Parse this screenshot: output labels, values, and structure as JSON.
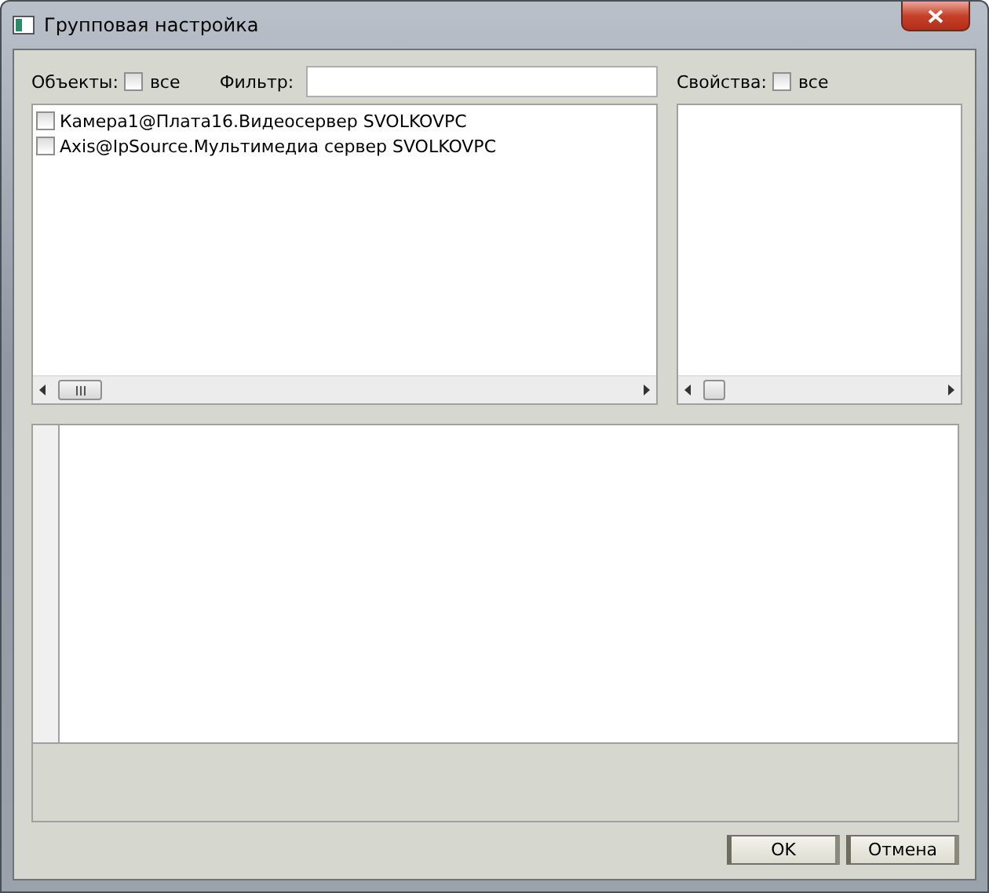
{
  "window": {
    "title": "Групповая настройка"
  },
  "objects": {
    "label": "Объекты:",
    "all_label": "все",
    "all_checked": false
  },
  "filter": {
    "label": "Фильтр:"
  },
  "properties": {
    "label": "Свойства:",
    "all_label": "все",
    "all_checked": false
  },
  "items": [
    {
      "label": "Камера1@Плата16.Видеосервер SVOLKOVPC",
      "checked": false
    },
    {
      "label": "Axis@IpSource.Мультимедиа сервер SVOLKOVPC",
      "checked": false
    }
  ],
  "buttons": [
    "OK",
    "Отмена"
  ]
}
